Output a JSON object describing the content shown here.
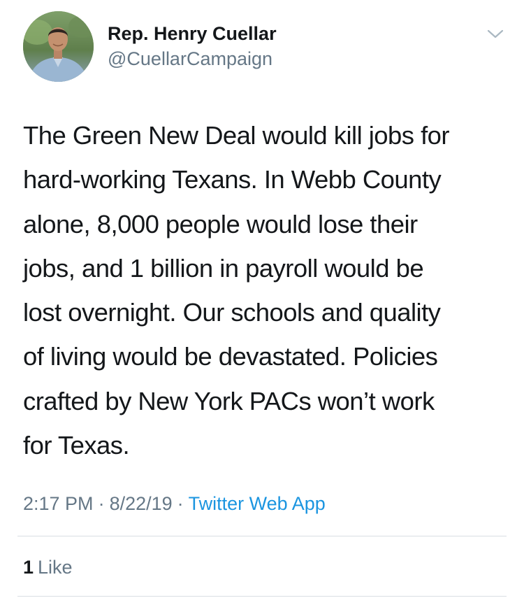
{
  "tweet": {
    "author": {
      "display_name": "Rep. Henry Cuellar",
      "handle": "@CuellarCampaign"
    },
    "text": "The Green New Deal would kill jobs for\nhard-working Texans. In Webb County\nalone, 8,000 people would lose their\njobs, and 1 billion in payroll would be\nlost overnight. Our schools and quality\nof living would be devastated. Policies\ncrafted by New York PACs won’t work\nfor Texas.",
    "time": "2:17 PM",
    "separator": "·",
    "date": "8/22/19",
    "source": "Twitter Web App",
    "likes_count": "1",
    "likes_label": "Like"
  },
  "icons": {
    "caret": "chevron-down-icon",
    "avatar": "profile-photo"
  },
  "colors": {
    "text": "#14171a",
    "secondary": "#657786",
    "link": "#1b95e0",
    "divider": "#d9dee3"
  }
}
